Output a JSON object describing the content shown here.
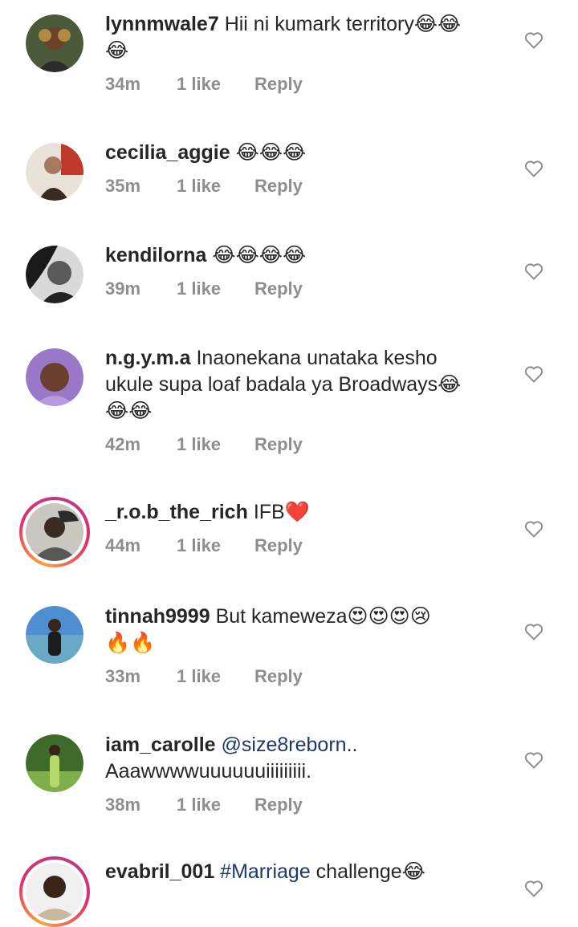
{
  "comments": [
    {
      "username": "lynnmwale7",
      "text_lines": [
        "Hii ni kumark territory😂😂",
        "😂"
      ],
      "time": "34m",
      "likes": "1 like",
      "reply": "Reply"
    },
    {
      "username": "cecilia_aggie",
      "text_lines": [
        "😂😂😂"
      ],
      "time": "35m",
      "likes": "1 like",
      "reply": "Reply"
    },
    {
      "username": "kendilorna",
      "text_lines": [
        "😂😂😂😂"
      ],
      "time": "39m",
      "likes": "1 like",
      "reply": "Reply"
    },
    {
      "username": "n.g.y.m.a",
      "text_lines": [
        "Inaonekana unataka kesho",
        "ukule supa loaf badala ya Broadways😂",
        "😂😂"
      ],
      "time": "42m",
      "likes": "1 like",
      "reply": "Reply"
    },
    {
      "username": "_r.o.b_the_rich",
      "text_lines": [
        "IFB❤️"
      ],
      "time": "44m",
      "likes": "1 like",
      "reply": "Reply"
    },
    {
      "username": "tinnah9999",
      "text_lines": [
        "But kameweza😍😍😍😢",
        "🔥🔥"
      ],
      "time": "33m",
      "likes": "1 like",
      "reply": "Reply"
    },
    {
      "username": "iam_carolle",
      "mention": "@size8reborn",
      "text_lines": [
        "..",
        "Aaawwwwuuuuuuiiiiiiiii."
      ],
      "time": "38m",
      "likes": "1 like",
      "reply": "Reply"
    },
    {
      "username": "evabril_001",
      "hashtag": "#Marriage",
      "text_lines": [
        " challenge😂"
      ]
    }
  ],
  "icons": {
    "like": "heart-outline-icon"
  },
  "colors": {
    "meta": "#8e8e8e",
    "link": "#1a3a6b",
    "story_ring": "#e1306c"
  }
}
